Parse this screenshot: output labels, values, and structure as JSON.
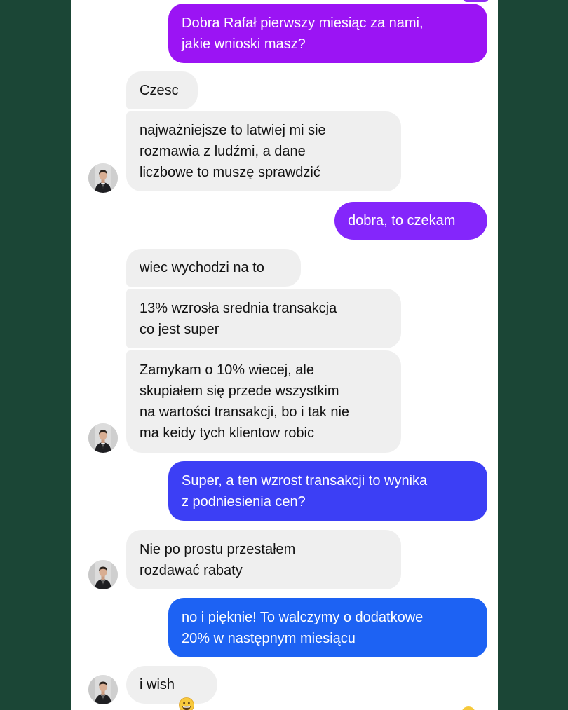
{
  "conversation": {
    "messages": [
      {
        "id": "m1",
        "direction": "outgoing",
        "color": "#9b14f4",
        "text": "Dobra Rafał pierwszy miesiąc za nami,\njakie wnioski masz?"
      },
      {
        "id": "m2",
        "direction": "incoming",
        "text": "Czesc"
      },
      {
        "id": "m3",
        "direction": "incoming",
        "text": "najważniejsze to latwiej mi sie\nrozmawia z ludźmi, a dane\nliczbowe to muszę sprawdzić"
      },
      {
        "id": "m4",
        "direction": "outgoing",
        "color": "#8426fb",
        "text": "dobra, to czekam"
      },
      {
        "id": "m5",
        "direction": "incoming",
        "text": "wiec wychodzi na to"
      },
      {
        "id": "m6",
        "direction": "incoming",
        "text": "13% wzrosła srednia transakcja\nco jest super"
      },
      {
        "id": "m7",
        "direction": "incoming",
        "text": "Zamykam o 10% wiecej, ale\nskupiałem się przede wszystkim\nna wartości transakcji, bo i tak nie\nma keidy tych klientow robic"
      },
      {
        "id": "m8",
        "direction": "outgoing",
        "color": "#3c3ff5",
        "text": "Super, a ten wzrost transakcji to wynika\nz podniesienia cen?"
      },
      {
        "id": "m9",
        "direction": "incoming",
        "text": "Nie po prostu przestałem\nrozdawać rabaty"
      },
      {
        "id": "m10",
        "direction": "outgoing",
        "color": "#1d62f3",
        "text": "no i pięknie! To walczymy o dodatkowe\n20% w następnym miesiącu"
      },
      {
        "id": "m11",
        "direction": "incoming",
        "text": "i wish",
        "emoji": "grinning-face-emoji"
      }
    ],
    "avatars": [
      {
        "id": "a1",
        "icon": "contact-avatar"
      },
      {
        "id": "a2",
        "icon": "contact-avatar"
      },
      {
        "id": "a3",
        "icon": "contact-avatar"
      },
      {
        "id": "a4",
        "icon": "contact-avatar"
      }
    ]
  },
  "theme": {
    "page_background": "#1b4636",
    "chat_background": "#ffffff",
    "incoming_bubble": "#efefef",
    "incoming_text": "#111111",
    "outgoing_text": "#ffffff"
  }
}
